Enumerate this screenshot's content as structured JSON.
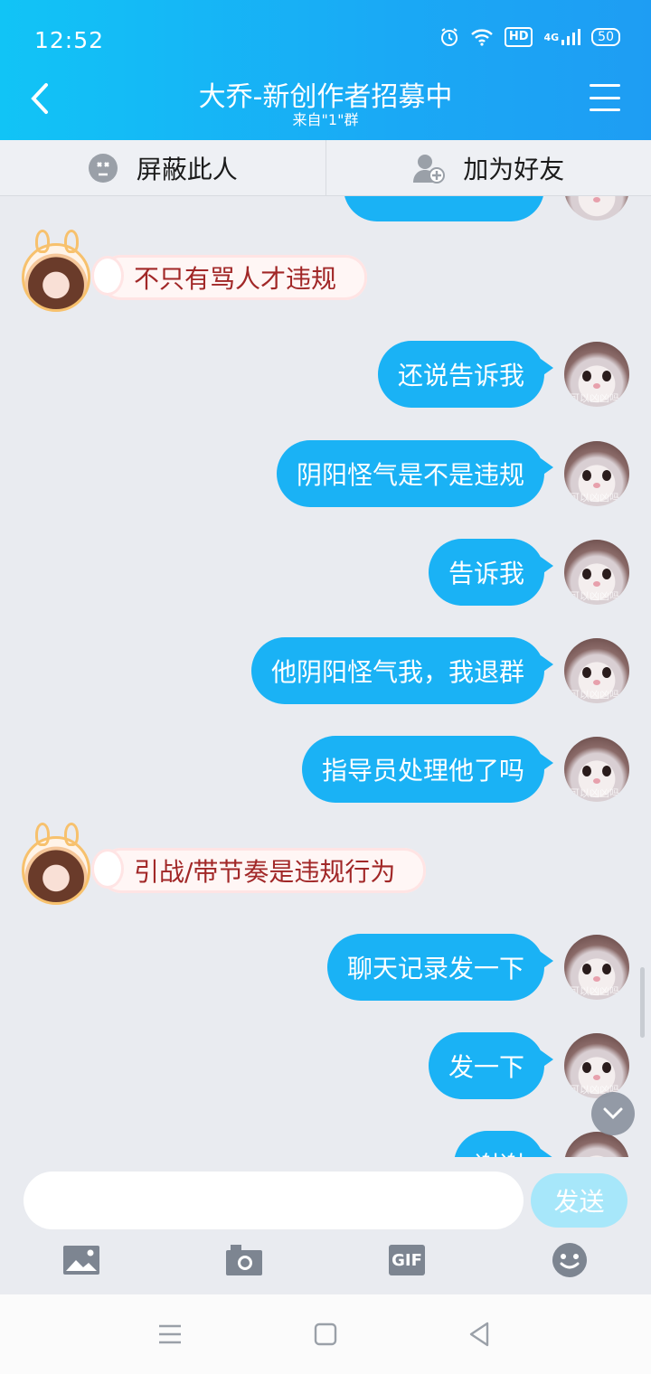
{
  "status_bar": {
    "time": "12:52",
    "signal_label": "4G",
    "hd_label": "HD",
    "battery": "50"
  },
  "header": {
    "title": "大乔-新创作者招募中",
    "subtitle": "来自\"1\"群"
  },
  "actions": {
    "block_label": "屏蔽此人",
    "add_friend_label": "加为好友"
  },
  "messages_incoming": [
    "不只有骂人才违规",
    "引战/带节奏是违规行为"
  ],
  "messages_outgoing": [
    "还说告诉我",
    "阴阳怪气是不是违规",
    "告诉我",
    "他阴阳怪气我，我退群",
    "指导员处理他了吗",
    "聊天记录发一下",
    "发一下",
    "谢谢"
  ],
  "avatar_watermark": "可以凶凶吗",
  "input": {
    "placeholder": "",
    "send_label": "发送"
  },
  "toolbar": {
    "gif_label": "GIF"
  },
  "colors": {
    "header_start": "#11c4f6",
    "header_end": "#1e9df3",
    "bubble_out": "#1ab2f5",
    "incoming_text": "#a12727",
    "send_disabled": "#a7e7fa"
  }
}
